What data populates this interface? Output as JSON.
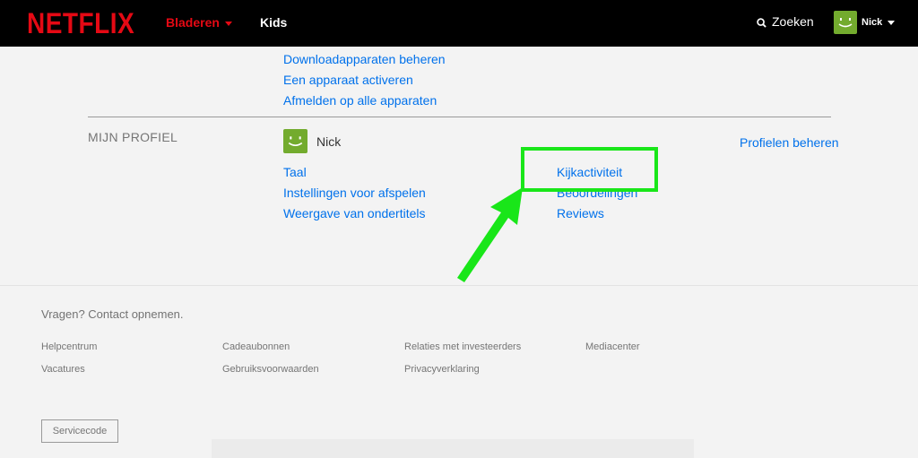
{
  "header": {
    "logo": "NETFLIX",
    "nav_browse": "Bladeren",
    "nav_kids": "Kids",
    "search_label": "Zoeken",
    "profile_name": "Nick"
  },
  "device_links": [
    "Downloadapparaten beheren",
    "Een apparaat activeren",
    "Afmelden op alle apparaten"
  ],
  "profile_section": {
    "label": "MIJN PROFIEL",
    "name": "Nick",
    "manage_link": "Profielen beheren",
    "left_links": [
      "Taal",
      "Instellingen voor afspelen",
      "Weergave van ondertitels"
    ],
    "right_links": [
      "Kijkactiviteit",
      "Beoordelingen",
      "Reviews"
    ]
  },
  "footer": {
    "question": "Vragen? Contact opnemen.",
    "col1": [
      "Helpcentrum",
      "Vacatures"
    ],
    "col2": [
      "Cadeaubonnen",
      "Gebruiksvoorwaarden"
    ],
    "col3": [
      "Relaties met investeerders",
      "Privacyverklaring"
    ],
    "col4": [
      "Mediacenter"
    ],
    "service_code": "Servicecode"
  },
  "colors": {
    "netflix_red": "#e50914",
    "link_blue": "#0071eb",
    "highlight_green": "#19e619",
    "avatar_green": "#73ab2e"
  }
}
